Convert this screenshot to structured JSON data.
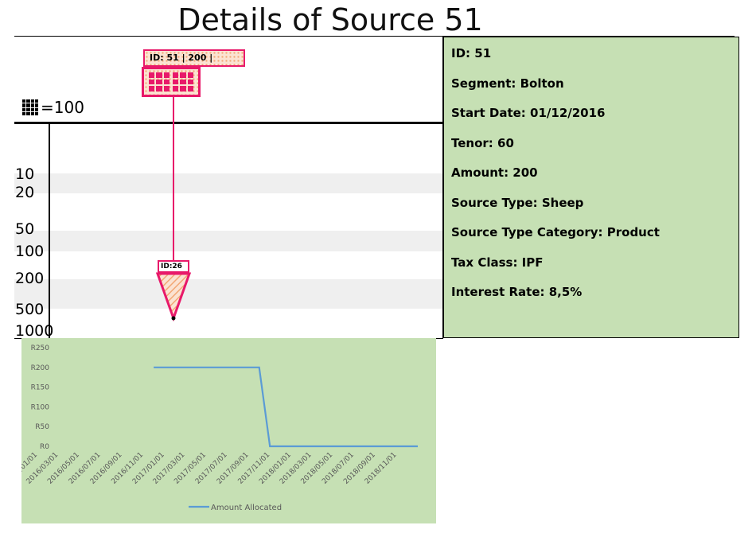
{
  "title": "Details of Source 51",
  "legend": {
    "icon": "grid-icon",
    "text": "=100"
  },
  "graphic": {
    "tag_text": "ID: 51 | 200 |",
    "node_label": "ID:26",
    "y_labels": [
      "10",
      "20",
      "50",
      "100",
      "200",
      "500",
      "1000"
    ],
    "accent": "#e8196a",
    "fill": "#fbe3d2",
    "fill_dots": "#f2a774"
  },
  "details": {
    "id": "ID: 51",
    "segment": "Segment: Bolton",
    "start_date": "Start Date: 01/12/2016",
    "tenor": "Tenor: 60",
    "amount": "Amount: 200",
    "source_type": "Source Type: Sheep",
    "source_type_category": "Source Type Category:  Product",
    "tax_class": "Tax Class: IPF",
    "interest_rate": "Interest Rate: 8,5%",
    "background": "#c6e0b4"
  },
  "chart_data": {
    "type": "line",
    "categories": [
      "2016/01/01",
      "2016/03/01",
      "2016/05/01",
      "2016/07/01",
      "2016/09/01",
      "2016/11/01",
      "2017/01/01",
      "2017/03/01",
      "2017/05/01",
      "2017/07/01",
      "2017/09/01",
      "2017/11/01",
      "2018/01/01",
      "2018/03/01",
      "2018/05/01",
      "2018/07/01",
      "2018/09/01",
      "2018/11/01"
    ],
    "y_ticks": [
      "R250",
      "R200",
      "R150",
      "R100",
      "R50",
      "R0"
    ],
    "ylim": [
      0,
      250
    ],
    "series": [
      {
        "name": "Amount Allocated",
        "color": "#5b9bd5",
        "points": [
          {
            "x": "2016/12/01",
            "y": 200
          },
          {
            "x": "2017/10/01",
            "y": 200
          },
          {
            "x": "2017/11/01",
            "y": 0
          },
          {
            "x": "2019/01/01",
            "y": 0
          }
        ]
      }
    ],
    "grid": false,
    "legend_position": "bottom",
    "background": "#c6e0b4"
  }
}
